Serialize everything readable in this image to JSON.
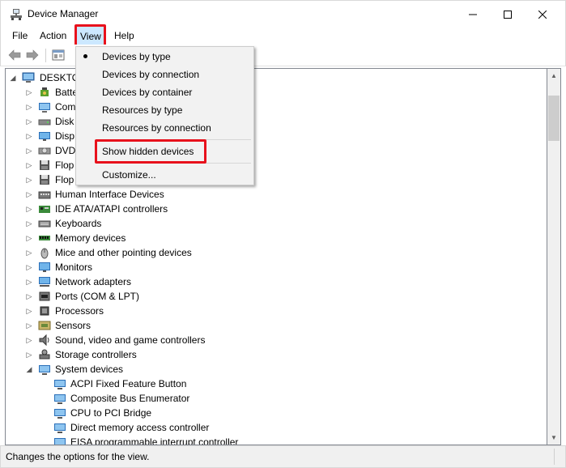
{
  "window": {
    "title": "Device Manager",
    "icon": "device-manager-icon"
  },
  "menubar": {
    "file": "File",
    "action": "Action",
    "view": "View",
    "help": "Help"
  },
  "toolbar": {
    "icons": [
      "back-arrow-icon",
      "forward-arrow-icon",
      "properties-icon"
    ]
  },
  "tree": {
    "root": "DESKTOP",
    "categories": [
      {
        "label": "Batte",
        "icon": "battery-icon"
      },
      {
        "label": "Com",
        "icon": "computer-icon"
      },
      {
        "label": "Disk",
        "icon": "disk-drive-icon"
      },
      {
        "label": "Disp",
        "icon": "display-adapter-icon"
      },
      {
        "label": "DVD",
        "icon": "dvd-drive-icon"
      },
      {
        "label": "Flop",
        "icon": "floppy-controller-icon"
      },
      {
        "label": "Flop",
        "icon": "floppy-drive-icon"
      },
      {
        "label": "Human Interface Devices",
        "icon": "hid-icon"
      },
      {
        "label": "IDE ATA/ATAPI controllers",
        "icon": "ide-controller-icon"
      },
      {
        "label": "Keyboards",
        "icon": "keyboard-icon"
      },
      {
        "label": "Memory devices",
        "icon": "memory-icon"
      },
      {
        "label": "Mice and other pointing devices",
        "icon": "mouse-icon"
      },
      {
        "label": "Monitors",
        "icon": "monitor-icon"
      },
      {
        "label": "Network adapters",
        "icon": "network-adapter-icon"
      },
      {
        "label": "Ports (COM & LPT)",
        "icon": "port-icon"
      },
      {
        "label": "Processors",
        "icon": "processor-icon"
      },
      {
        "label": "Sensors",
        "icon": "sensor-icon"
      },
      {
        "label": "Sound, video and game controllers",
        "icon": "sound-icon"
      },
      {
        "label": "Storage controllers",
        "icon": "storage-controller-icon"
      },
      {
        "label": "System devices",
        "icon": "system-devices-icon"
      }
    ],
    "system_children": [
      "ACPI Fixed Feature Button",
      "Composite Bus Enumerator",
      "CPU to PCI Bridge",
      "Direct memory access controller",
      "EISA programmable interrupt controller"
    ]
  },
  "view_menu": {
    "items": [
      {
        "label": "Devices by type",
        "checked": true
      },
      {
        "label": "Devices by connection",
        "checked": false
      },
      {
        "label": "Devices by container",
        "checked": false
      },
      {
        "label": "Resources by type",
        "checked": false
      },
      {
        "label": "Resources by connection",
        "checked": false
      },
      {
        "label": "Show hidden devices",
        "checked": false
      },
      {
        "label": "Customize...",
        "checked": false
      }
    ]
  },
  "statusbar": {
    "text": "Changes the options for the view."
  },
  "colors": {
    "highlight_red": "#e8111c",
    "menu_hover": "#cce8ff",
    "menu_bg": "#f2f2f2"
  }
}
